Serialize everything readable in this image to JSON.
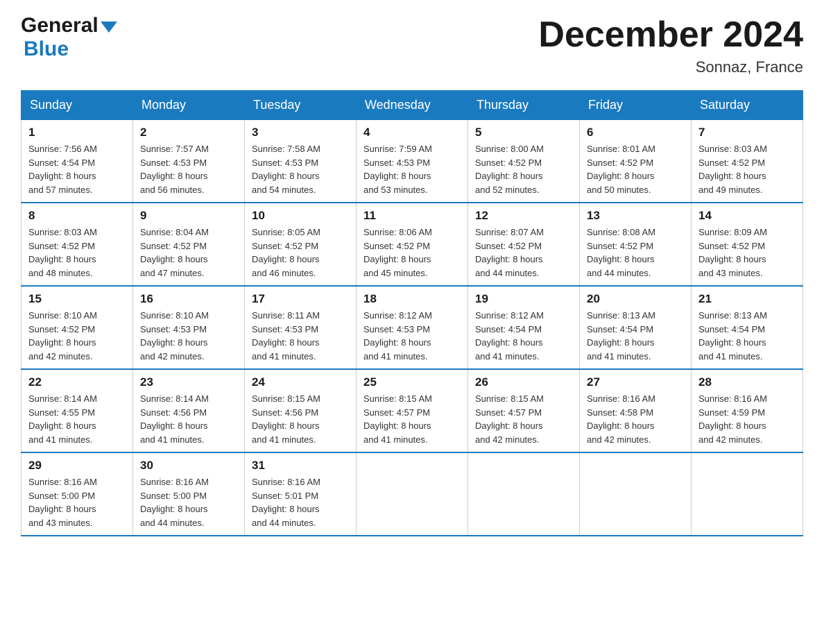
{
  "header": {
    "logo_general": "General",
    "logo_blue": "Blue",
    "title": "December 2024",
    "location": "Sonnaz, France"
  },
  "days_of_week": [
    "Sunday",
    "Monday",
    "Tuesday",
    "Wednesday",
    "Thursday",
    "Friday",
    "Saturday"
  ],
  "weeks": [
    [
      {
        "num": "1",
        "sunrise": "7:56 AM",
        "sunset": "4:54 PM",
        "daylight_hours": "8 hours",
        "daylight_min": "and 57 minutes."
      },
      {
        "num": "2",
        "sunrise": "7:57 AM",
        "sunset": "4:53 PM",
        "daylight_hours": "8 hours",
        "daylight_min": "and 56 minutes."
      },
      {
        "num": "3",
        "sunrise": "7:58 AM",
        "sunset": "4:53 PM",
        "daylight_hours": "8 hours",
        "daylight_min": "and 54 minutes."
      },
      {
        "num": "4",
        "sunrise": "7:59 AM",
        "sunset": "4:53 PM",
        "daylight_hours": "8 hours",
        "daylight_min": "and 53 minutes."
      },
      {
        "num": "5",
        "sunrise": "8:00 AM",
        "sunset": "4:52 PM",
        "daylight_hours": "8 hours",
        "daylight_min": "and 52 minutes."
      },
      {
        "num": "6",
        "sunrise": "8:01 AM",
        "sunset": "4:52 PM",
        "daylight_hours": "8 hours",
        "daylight_min": "and 50 minutes."
      },
      {
        "num": "7",
        "sunrise": "8:03 AM",
        "sunset": "4:52 PM",
        "daylight_hours": "8 hours",
        "daylight_min": "and 49 minutes."
      }
    ],
    [
      {
        "num": "8",
        "sunrise": "8:03 AM",
        "sunset": "4:52 PM",
        "daylight_hours": "8 hours",
        "daylight_min": "and 48 minutes."
      },
      {
        "num": "9",
        "sunrise": "8:04 AM",
        "sunset": "4:52 PM",
        "daylight_hours": "8 hours",
        "daylight_min": "and 47 minutes."
      },
      {
        "num": "10",
        "sunrise": "8:05 AM",
        "sunset": "4:52 PM",
        "daylight_hours": "8 hours",
        "daylight_min": "and 46 minutes."
      },
      {
        "num": "11",
        "sunrise": "8:06 AM",
        "sunset": "4:52 PM",
        "daylight_hours": "8 hours",
        "daylight_min": "and 45 minutes."
      },
      {
        "num": "12",
        "sunrise": "8:07 AM",
        "sunset": "4:52 PM",
        "daylight_hours": "8 hours",
        "daylight_min": "and 44 minutes."
      },
      {
        "num": "13",
        "sunrise": "8:08 AM",
        "sunset": "4:52 PM",
        "daylight_hours": "8 hours",
        "daylight_min": "and 44 minutes."
      },
      {
        "num": "14",
        "sunrise": "8:09 AM",
        "sunset": "4:52 PM",
        "daylight_hours": "8 hours",
        "daylight_min": "and 43 minutes."
      }
    ],
    [
      {
        "num": "15",
        "sunrise": "8:10 AM",
        "sunset": "4:52 PM",
        "daylight_hours": "8 hours",
        "daylight_min": "and 42 minutes."
      },
      {
        "num": "16",
        "sunrise": "8:10 AM",
        "sunset": "4:53 PM",
        "daylight_hours": "8 hours",
        "daylight_min": "and 42 minutes."
      },
      {
        "num": "17",
        "sunrise": "8:11 AM",
        "sunset": "4:53 PM",
        "daylight_hours": "8 hours",
        "daylight_min": "and 41 minutes."
      },
      {
        "num": "18",
        "sunrise": "8:12 AM",
        "sunset": "4:53 PM",
        "daylight_hours": "8 hours",
        "daylight_min": "and 41 minutes."
      },
      {
        "num": "19",
        "sunrise": "8:12 AM",
        "sunset": "4:54 PM",
        "daylight_hours": "8 hours",
        "daylight_min": "and 41 minutes."
      },
      {
        "num": "20",
        "sunrise": "8:13 AM",
        "sunset": "4:54 PM",
        "daylight_hours": "8 hours",
        "daylight_min": "and 41 minutes."
      },
      {
        "num": "21",
        "sunrise": "8:13 AM",
        "sunset": "4:54 PM",
        "daylight_hours": "8 hours",
        "daylight_min": "and 41 minutes."
      }
    ],
    [
      {
        "num": "22",
        "sunrise": "8:14 AM",
        "sunset": "4:55 PM",
        "daylight_hours": "8 hours",
        "daylight_min": "and 41 minutes."
      },
      {
        "num": "23",
        "sunrise": "8:14 AM",
        "sunset": "4:56 PM",
        "daylight_hours": "8 hours",
        "daylight_min": "and 41 minutes."
      },
      {
        "num": "24",
        "sunrise": "8:15 AM",
        "sunset": "4:56 PM",
        "daylight_hours": "8 hours",
        "daylight_min": "and 41 minutes."
      },
      {
        "num": "25",
        "sunrise": "8:15 AM",
        "sunset": "4:57 PM",
        "daylight_hours": "8 hours",
        "daylight_min": "and 41 minutes."
      },
      {
        "num": "26",
        "sunrise": "8:15 AM",
        "sunset": "4:57 PM",
        "daylight_hours": "8 hours",
        "daylight_min": "and 42 minutes."
      },
      {
        "num": "27",
        "sunrise": "8:16 AM",
        "sunset": "4:58 PM",
        "daylight_hours": "8 hours",
        "daylight_min": "and 42 minutes."
      },
      {
        "num": "28",
        "sunrise": "8:16 AM",
        "sunset": "4:59 PM",
        "daylight_hours": "8 hours",
        "daylight_min": "and 42 minutes."
      }
    ],
    [
      {
        "num": "29",
        "sunrise": "8:16 AM",
        "sunset": "5:00 PM",
        "daylight_hours": "8 hours",
        "daylight_min": "and 43 minutes."
      },
      {
        "num": "30",
        "sunrise": "8:16 AM",
        "sunset": "5:00 PM",
        "daylight_hours": "8 hours",
        "daylight_min": "and 44 minutes."
      },
      {
        "num": "31",
        "sunrise": "8:16 AM",
        "sunset": "5:01 PM",
        "daylight_hours": "8 hours",
        "daylight_min": "and 44 minutes."
      },
      null,
      null,
      null,
      null
    ]
  ],
  "labels": {
    "sunrise": "Sunrise:",
    "sunset": "Sunset:",
    "daylight": "Daylight:"
  }
}
